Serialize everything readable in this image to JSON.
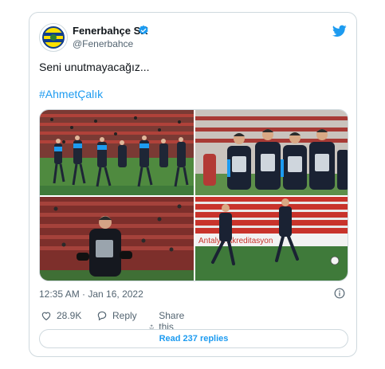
{
  "author": {
    "name": "Fenerbahçe SK",
    "handle": "@Fenerbahce"
  },
  "tweet": {
    "text": "Seni unutmayacağız...",
    "hashtag": "#AhmetÇalık",
    "timestamp": "12:35 AM · Jan 16, 2022"
  },
  "actions": {
    "likes": "28.9K",
    "reply_label": "Reply",
    "share_label": "Share this Tweet"
  },
  "replies_button": "Read 237 replies",
  "photo_overlay": {
    "ad_text": "Antalya Akreditasyon"
  },
  "colors": {
    "accent": "#1d9bf0",
    "text_primary": "#0f1419",
    "text_secondary": "#536471",
    "border": "#cfd9de",
    "pitch_green": "#3f7a3a",
    "stand_red": "#c8332b"
  },
  "icons": [
    "fenerbahce-logo-icon",
    "verified-badge-icon",
    "twitter-bird-icon",
    "info-icon",
    "heart-icon",
    "reply-icon",
    "share-icon"
  ]
}
